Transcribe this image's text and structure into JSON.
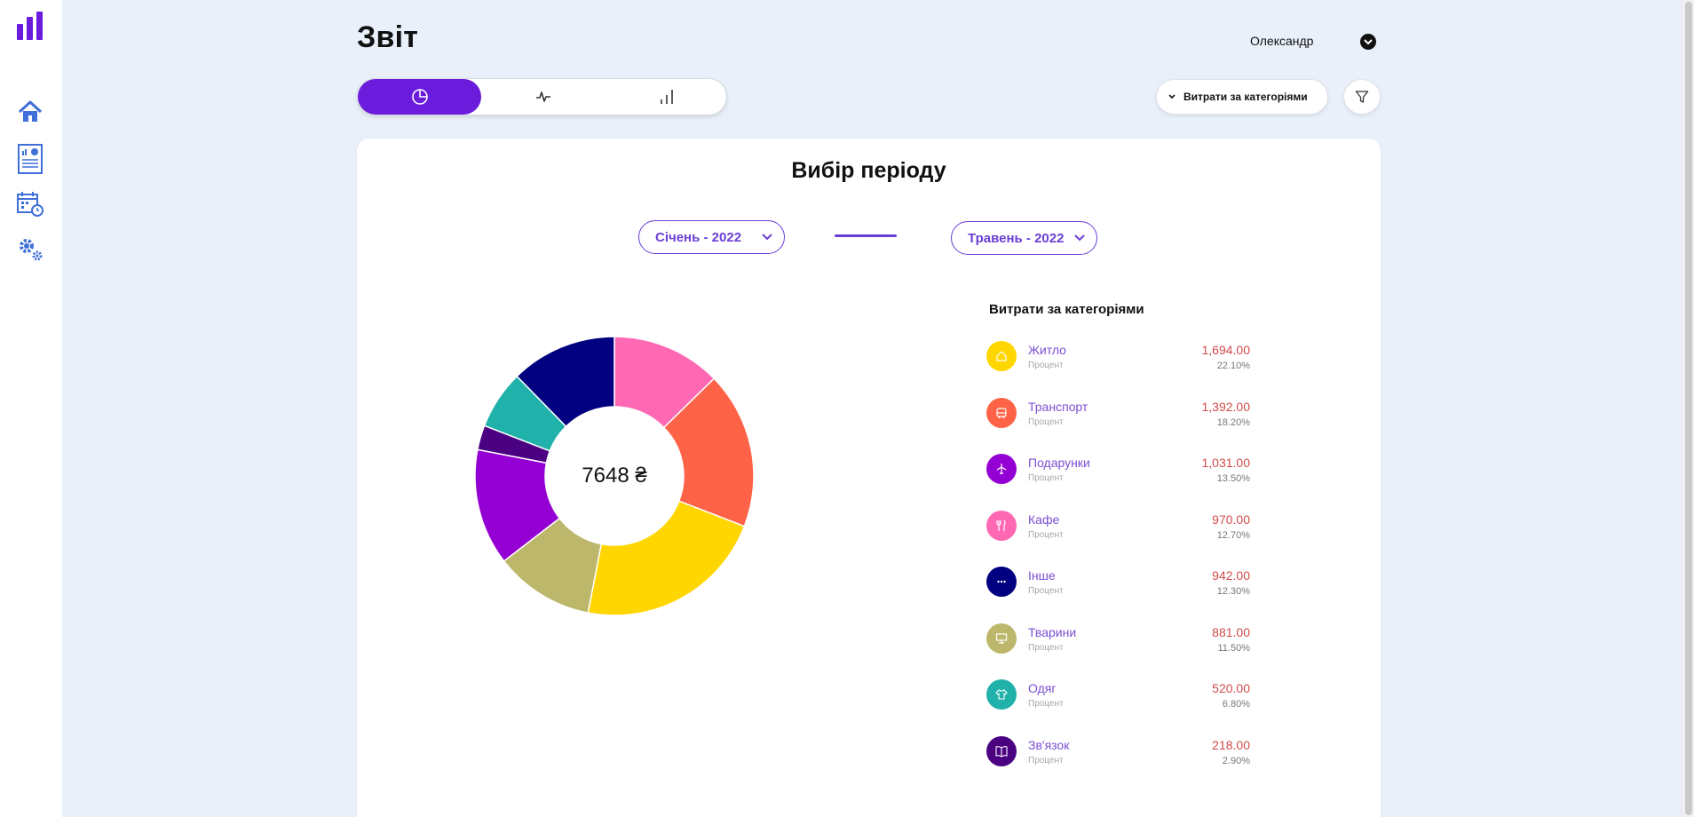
{
  "header": {
    "title": "Звіт",
    "user_name": "Олександр",
    "category_select": "Витрати за категоріями"
  },
  "colors": {
    "accent": "#6a1bdc",
    "amount": "#d24b4b",
    "category_text": "#7a4fd3"
  },
  "sidebar": {
    "items": [
      {
        "icon": "home-icon"
      },
      {
        "icon": "report-icon"
      },
      {
        "icon": "calendar-icon"
      },
      {
        "icon": "settings-icon"
      }
    ]
  },
  "tabs": [
    {
      "icon": "pie-chart-icon",
      "active": true
    },
    {
      "icon": "line-chart-icon",
      "active": false
    },
    {
      "icon": "bar-chart-icon",
      "active": false
    }
  ],
  "card": {
    "title": "Вибір періоду",
    "period_from": "Січень - 2022",
    "period_to": "Травень - 2022",
    "total": "7648 ₴"
  },
  "legend": {
    "title": "Витрати за категоріями",
    "sub_label": "Процент",
    "items": [
      {
        "name": "Житло",
        "amount": "1,694.00",
        "percent": "22.10%",
        "color": "#ffd600",
        "icon": "house-icon"
      },
      {
        "name": "Транспорт",
        "amount": "1,392.00",
        "percent": "18.20%",
        "color": "#ff6347",
        "icon": "bus-icon"
      },
      {
        "name": "Подарунки",
        "amount": "1,031.00",
        "percent": "13.50%",
        "color": "#9400d3",
        "icon": "plane-icon"
      },
      {
        "name": "Кафе",
        "amount": "970.00",
        "percent": "12.70%",
        "color": "#ff69b4",
        "icon": "cutlery-icon"
      },
      {
        "name": "Інше",
        "amount": "942.00",
        "percent": "12.30%",
        "color": "#000080",
        "icon": "more-icon"
      },
      {
        "name": "Тварини",
        "amount": "881.00",
        "percent": "11.50%",
        "color": "#bdb76b",
        "icon": "monitor-icon"
      },
      {
        "name": "Одяг",
        "amount": "520.00",
        "percent": "6.80%",
        "color": "#20b2aa",
        "icon": "shirt-icon"
      },
      {
        "name": "Зв'язок",
        "amount": "218.00",
        "percent": "2.90%",
        "color": "#4b0082",
        "icon": "book-icon"
      }
    ]
  },
  "chart_data": {
    "type": "pie",
    "categories": [
      "Кафе",
      "Транспорт",
      "Житло",
      "Тварини",
      "Подарунки",
      "Зв'язок",
      "Одяг",
      "Інше"
    ],
    "values": [
      970,
      1392,
      1694,
      881,
      1031,
      218,
      520,
      942
    ],
    "colors": [
      "#ff69b4",
      "#ff6347",
      "#ffd600",
      "#bdb76b",
      "#9400d3",
      "#4b0082",
      "#20b2aa",
      "#000080"
    ],
    "donut": true,
    "total": 7648
  }
}
